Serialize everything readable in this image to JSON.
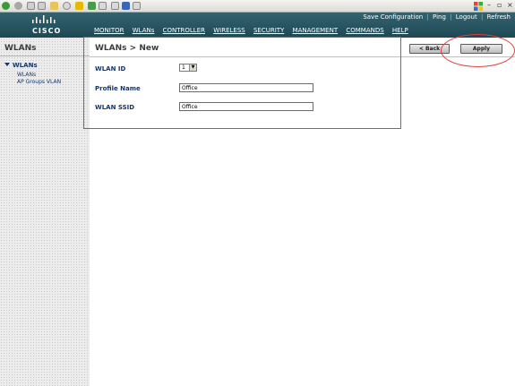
{
  "header": {
    "logo_text": "CISCO",
    "util_links": [
      "Save Configuration",
      "Ping",
      "Logout",
      "Refresh"
    ],
    "nav": [
      "MONITOR",
      "WLANs",
      "CONTROLLER",
      "WIRELESS",
      "SECURITY",
      "MANAGEMENT",
      "COMMANDS",
      "HELP"
    ]
  },
  "sidebar": {
    "title": "WLANs",
    "tree_root": "WLANs",
    "children": [
      "WLANs",
      "AP Groups VLAN"
    ]
  },
  "main": {
    "title": "WLANs > New",
    "back_label": "< Back",
    "apply_label": "Apply",
    "fields": {
      "wlan_id": {
        "label": "WLAN ID",
        "value": "1"
      },
      "profile_name": {
        "label": "Profile Name",
        "value": "Office"
      },
      "wlan_ssid": {
        "label": "WLAN SSID",
        "value": "Office"
      }
    }
  },
  "colors": {
    "header_bg": "#2a5965",
    "accent_red": "#e53b3b",
    "label_blue": "#14366e"
  }
}
